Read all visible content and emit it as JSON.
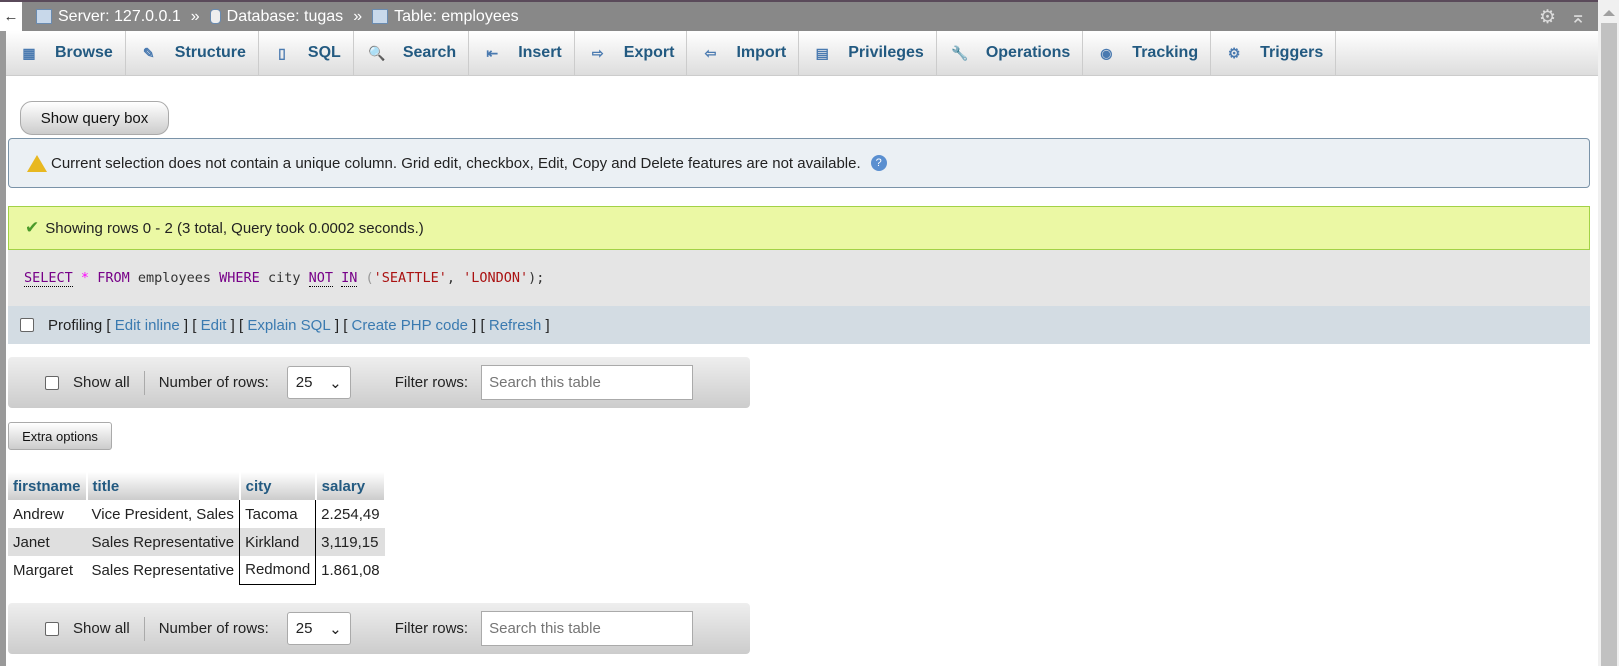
{
  "breadcrumb": {
    "back": "←",
    "server": "Server: 127.0.0.1",
    "database": "Database: tugas",
    "table": "Table: employees",
    "sep": "»"
  },
  "tabs": [
    {
      "label": "Browse",
      "icon": "browse-icon",
      "glyph": "▦"
    },
    {
      "label": "Structure",
      "icon": "structure-icon",
      "glyph": "✎"
    },
    {
      "label": "SQL",
      "icon": "sql-icon",
      "glyph": "▯"
    },
    {
      "label": "Search",
      "icon": "search-icon",
      "glyph": "🔍"
    },
    {
      "label": "Insert",
      "icon": "insert-icon",
      "glyph": "⇤"
    },
    {
      "label": "Export",
      "icon": "export-icon",
      "glyph": "⇨"
    },
    {
      "label": "Import",
      "icon": "import-icon",
      "glyph": "⇦"
    },
    {
      "label": "Privileges",
      "icon": "privileges-icon",
      "glyph": "▤"
    },
    {
      "label": "Operations",
      "icon": "wrench-icon",
      "glyph": "🔧"
    },
    {
      "label": "Tracking",
      "icon": "eye-icon",
      "glyph": "◉"
    },
    {
      "label": "Triggers",
      "icon": "triggers-icon",
      "glyph": "⚙"
    }
  ],
  "show_query_box": "Show query box",
  "notice": "Current selection does not contain a unique column. Grid edit, checkbox, Edit, Copy and Delete features are not available.",
  "success": "Showing rows 0 - 2 (3 total, Query took 0.0002 seconds.)",
  "sql": {
    "select": "SELECT",
    "star": "*",
    "from": "FROM",
    "table": "employees",
    "where": "WHERE",
    "col": "city",
    "not": "NOT",
    "in": "IN",
    "open": "(",
    "s1": "'SEATTLE'",
    "comma": ",",
    "s2": "'LONDON'",
    "close": ");"
  },
  "profiling": {
    "label": "Profiling",
    "links": [
      "Edit inline",
      "Edit",
      "Explain SQL",
      "Create PHP code",
      "Refresh"
    ]
  },
  "nav": {
    "show_all": "Show all",
    "rows_label": "Number of rows:",
    "rows_value": "25",
    "filter_label": "Filter rows:",
    "filter_placeholder": "Search this table"
  },
  "extra_options": "Extra options",
  "table": {
    "headers": [
      "firstname",
      "title",
      "city",
      "salary"
    ],
    "rows": [
      [
        "Andrew",
        "Vice President, Sales",
        "Tacoma",
        "2.254,49"
      ],
      [
        "Janet",
        "Sales Representative",
        "Kirkland",
        "3,119,15"
      ],
      [
        "Margaret",
        "Sales Representative",
        "Redmond",
        "1.861,08"
      ]
    ]
  }
}
